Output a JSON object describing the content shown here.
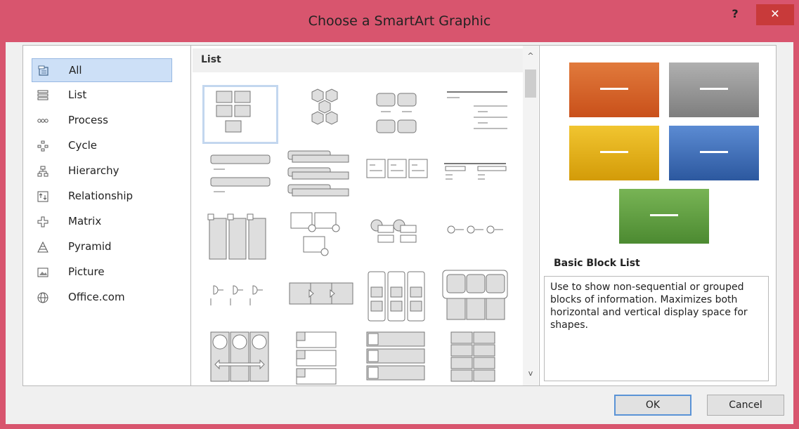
{
  "window": {
    "title": "Choose a SmartArt Graphic",
    "help": "?",
    "close": "✕"
  },
  "categories": [
    {
      "label": "All",
      "icon": "all-icon",
      "selected": true
    },
    {
      "label": "List",
      "icon": "list-icon"
    },
    {
      "label": "Process",
      "icon": "process-icon"
    },
    {
      "label": "Cycle",
      "icon": "cycle-icon"
    },
    {
      "label": "Hierarchy",
      "icon": "hierarchy-icon"
    },
    {
      "label": "Relationship",
      "icon": "relationship-icon"
    },
    {
      "label": "Matrix",
      "icon": "matrix-icon"
    },
    {
      "label": "Pyramid",
      "icon": "pyramid-icon"
    },
    {
      "label": "Picture",
      "icon": "picture-icon"
    },
    {
      "label": "Office.com",
      "icon": "globe-icon"
    }
  ],
  "gallery": {
    "header": "List",
    "scroll_up": "^",
    "scroll_down": "v"
  },
  "preview": {
    "title": "Basic Block List",
    "description": "Use to show non-sequential or grouped blocks of information. Maximizes both horizontal and vertical display space for shapes.",
    "colors": [
      "#d9641f",
      "#8f8f8f",
      "#e3ae0e",
      "#3c6ab3",
      "#5b9a3e"
    ]
  },
  "buttons": {
    "ok": "OK",
    "cancel": "Cancel"
  }
}
